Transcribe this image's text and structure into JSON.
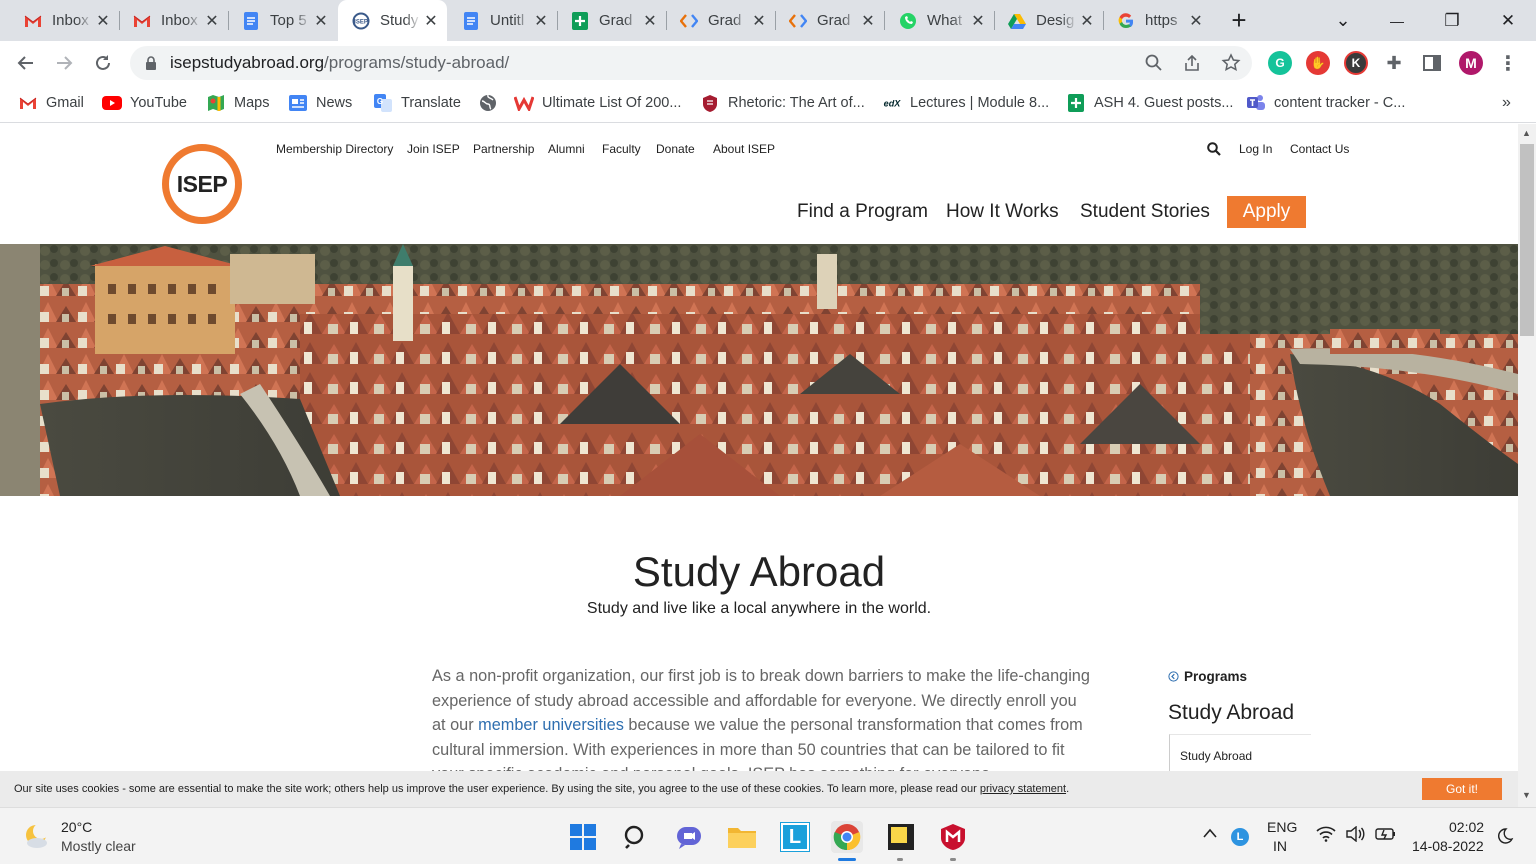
{
  "browser": {
    "tabs": [
      {
        "title": "Inbox",
        "icon": "gmail-icon",
        "active": false
      },
      {
        "title": "Inbox",
        "icon": "gmail-icon",
        "active": false
      },
      {
        "title": "Top 5",
        "icon": "docs-icon",
        "active": false
      },
      {
        "title": "Study",
        "icon": "isep-icon",
        "active": true
      },
      {
        "title": "Untitl",
        "icon": "docs-icon",
        "active": false
      },
      {
        "title": "Grad",
        "icon": "sheets-icon",
        "active": false
      },
      {
        "title": "Grad",
        "icon": "code-icon",
        "active": false
      },
      {
        "title": "Grad",
        "icon": "code-icon",
        "active": false
      },
      {
        "title": "What",
        "icon": "whatsapp-icon",
        "active": false
      },
      {
        "title": "Desig",
        "icon": "drive-icon",
        "active": false
      },
      {
        "title": "https",
        "icon": "google-icon",
        "active": false
      }
    ],
    "url_domain": "isepstudyabroad.org",
    "url_path": "/programs/study-abroad/",
    "profile_initial": "M",
    "bookmarks": [
      {
        "label": "Gmail",
        "icon": "gmail-icon"
      },
      {
        "label": "YouTube",
        "icon": "youtube-icon"
      },
      {
        "label": "Maps",
        "icon": "maps-icon"
      },
      {
        "label": "News",
        "icon": "news-icon"
      },
      {
        "label": "Translate",
        "icon": "translate-icon"
      },
      {
        "label": "",
        "icon": "globe-icon"
      },
      {
        "label": "Ultimate List Of 200...",
        "icon": "w-icon"
      },
      {
        "label": "Rhetoric: The Art of...",
        "icon": "shield-icon"
      },
      {
        "label": "Lectures | Module 8...",
        "icon": "edx-icon"
      },
      {
        "label": "ASH 4. Guest posts...",
        "icon": "sheets-icon"
      },
      {
        "label": "content tracker - C...",
        "icon": "teams-icon"
      }
    ]
  },
  "site": {
    "logo_text": "ISEP",
    "utility_nav": [
      "Membership Directory",
      "Join ISEP",
      "Partnership",
      "Alumni",
      "Faculty",
      "Donate",
      "About ISEP"
    ],
    "login": "Log In",
    "contact": "Contact Us",
    "main_nav": [
      "Find a Program",
      "How It Works",
      "Student Stories"
    ],
    "apply": "Apply",
    "page_title": "Study Abroad",
    "page_subtitle": "Study and live like a local anywhere in the world.",
    "body_before_link": "As a non-profit organization, our first job is to break down barriers to make the life-changing experience of study abroad accessible and affordable for everyone. We directly enroll you at our ",
    "body_link": "member universities",
    "body_after_link": " because we value the personal transformation that comes from cultural immersion. With experiences in more than 50 countries that can be tailored to fit your specific academic and personal goals, ISEP has something for everyone.",
    "sidebar": {
      "parent": "Programs",
      "title": "Study Abroad",
      "item": "Study Abroad"
    },
    "cookie_text": "Our site uses cookies - some are essential to make the site work; others help us improve the user experience. By using the site, you agree to the use of these cookies. To learn more, please read our ",
    "cookie_link": "privacy statement",
    "cookie_end": ".",
    "cookie_button": "Got it!"
  },
  "taskbar": {
    "weather_temp": "20°C",
    "weather_desc": "Mostly clear",
    "lang_top": "ENG",
    "lang_bottom": "IN",
    "time": "02:02",
    "date": "14-08-2022"
  },
  "colors": {
    "accent": "#ef7a30",
    "link": "#2f6fb0"
  }
}
